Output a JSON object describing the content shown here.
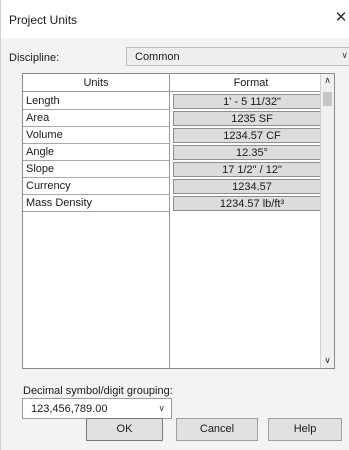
{
  "window": {
    "title": "Project Units",
    "close_glyph": "✕"
  },
  "discipline": {
    "label": "Discipline:",
    "value": "Common"
  },
  "table": {
    "headers": {
      "units": "Units",
      "format": "Format"
    },
    "rows": [
      {
        "unit": "Length",
        "format": "1' - 5 11/32\""
      },
      {
        "unit": "Area",
        "format": "1235 SF"
      },
      {
        "unit": "Volume",
        "format": "1234.57 CF"
      },
      {
        "unit": "Angle",
        "format": "12.35°"
      },
      {
        "unit": "Slope",
        "format": "17 1/2\" / 12\""
      },
      {
        "unit": "Currency",
        "format": "1234.57"
      },
      {
        "unit": "Mass Density",
        "format": "1234.57 lb/ft³"
      }
    ]
  },
  "decimal": {
    "label": "Decimal symbol/digit grouping:",
    "value": "123,456,789.00"
  },
  "buttons": {
    "ok": "OK",
    "cancel": "Cancel",
    "help": "Help"
  },
  "icons": {
    "close": "close-icon",
    "dropdown": "chevron-down-icon",
    "scroll_up": "chevron-up-icon",
    "scroll_down": "chevron-down-icon"
  }
}
